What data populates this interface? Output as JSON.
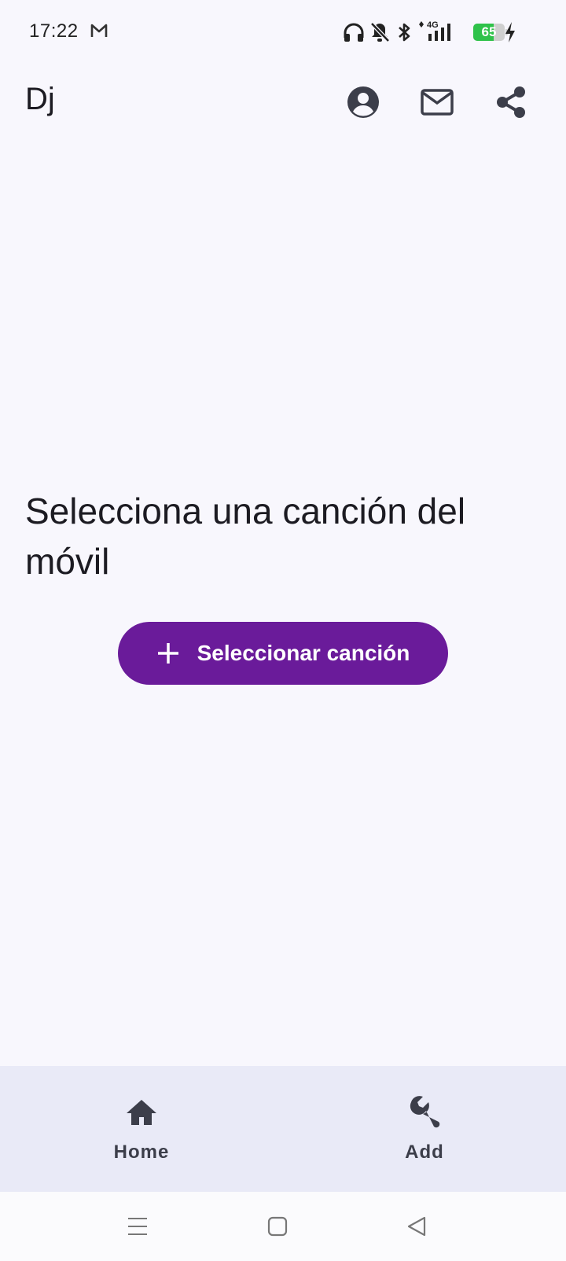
{
  "status_bar": {
    "time": "17:22",
    "battery_level": "65",
    "battery_fraction": 0.65,
    "network": "4G",
    "icons": [
      "gmail-icon",
      "headphones-icon",
      "notifications-off-icon",
      "bluetooth-icon",
      "signal-4g-icon",
      "battery-icon",
      "charging-bolt-icon"
    ]
  },
  "app_bar": {
    "title": "Dj",
    "actions": [
      "account-icon",
      "mail-icon",
      "share-icon"
    ]
  },
  "main": {
    "message": "Selecciona una canción del móvil",
    "select_button_label": "Seleccionar canción",
    "select_button_icon": "plus-icon"
  },
  "bottom_nav": {
    "items": [
      {
        "label": "Home",
        "icon": "home-icon"
      },
      {
        "label": "Add",
        "icon": "wrench-icon"
      }
    ]
  },
  "system_nav": {
    "icons": [
      "menu-lines-icon",
      "home-square-icon",
      "back-triangle-icon"
    ]
  },
  "colors": {
    "background": "#f8f7fd",
    "accent": "#6a1b9a",
    "nav_background": "#e9eaf7",
    "icon": "#3c3e4a",
    "battery": "#2fc24a"
  }
}
